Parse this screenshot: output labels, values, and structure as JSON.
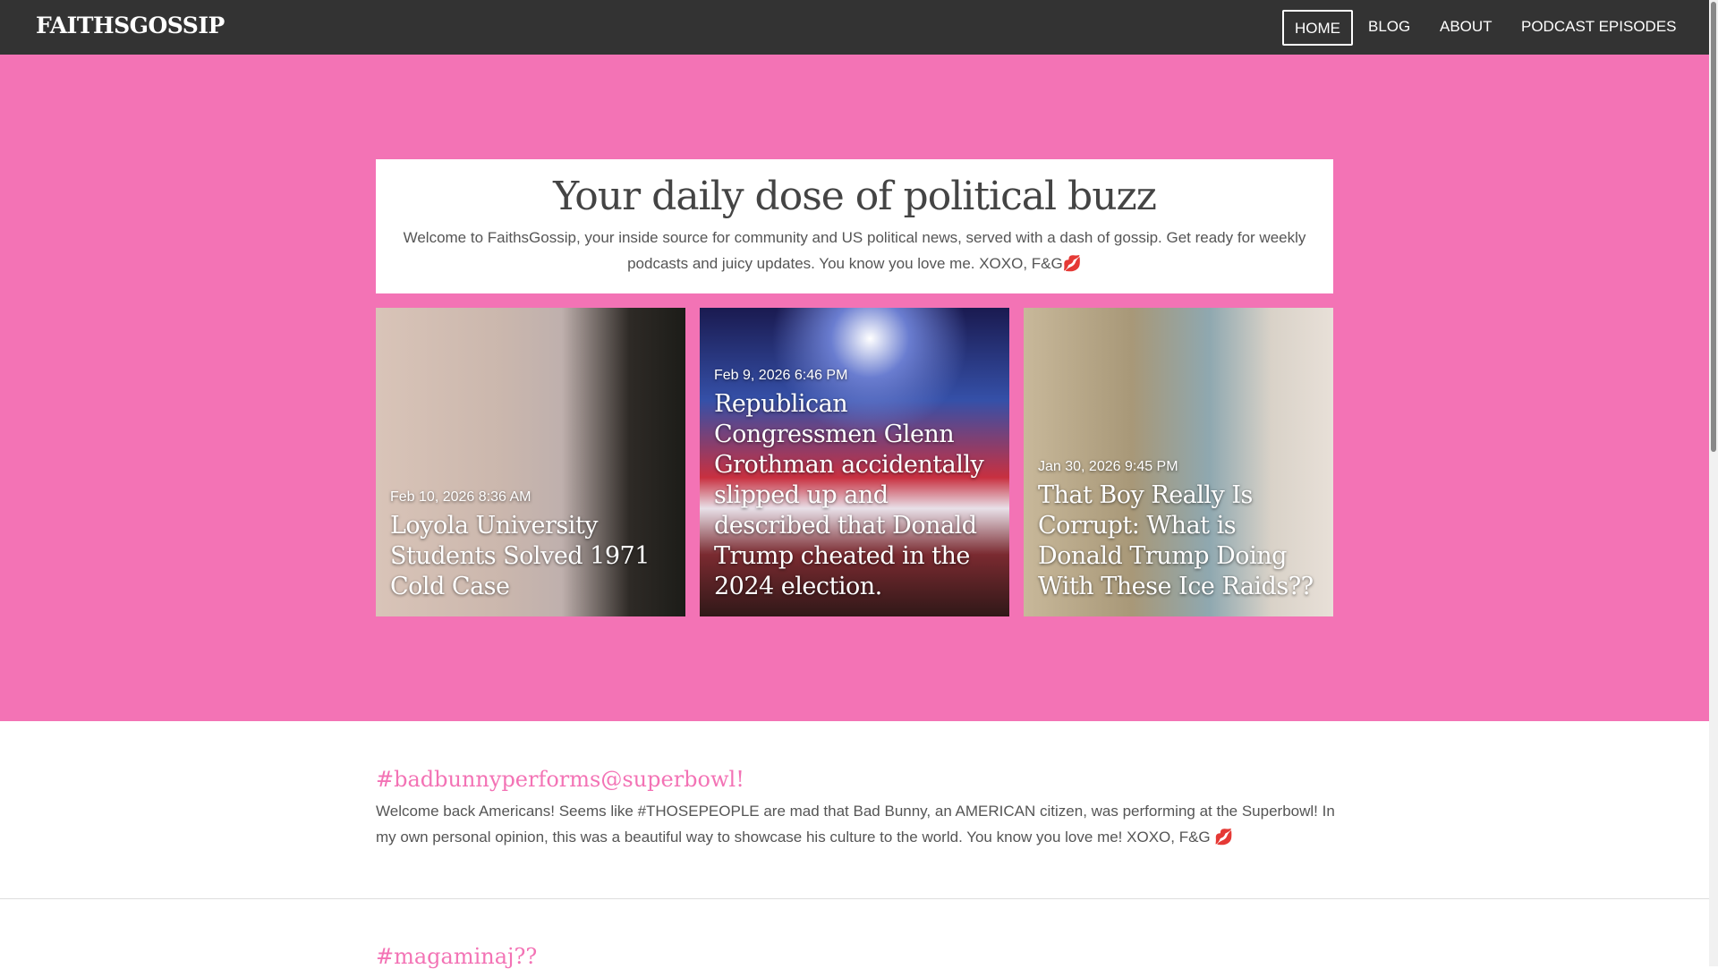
{
  "header": {
    "logo": "FAITHSGOSSIP",
    "nav": [
      "HOME",
      "BLOG",
      "ABOUT",
      "PODCAST EPISODES"
    ]
  },
  "intro": {
    "title": "Your daily dose of political buzz",
    "text": "Welcome to FaithsGossip, your inside source for community and US political news, served with a dash of gossip. Get ready for weekly podcasts and juicy updates. You know you love me. XOXO, F&G💋"
  },
  "featured": [
    {
      "date": "Feb 10, 2026 8:36 AM",
      "title": "Loyola University Students Solved 1971 Cold Case"
    },
    {
      "date": "Feb 9, 2026 6:46 PM",
      "title": "Republican Congressmen Glenn Grothman accidentally slipped up and described that Donald Trump cheated in the 2024 election."
    },
    {
      "date": "Jan 30, 2026 9:45 PM",
      "title": "That Boy Really Is Corrupt: What is Donald Trump Doing With These Ice Raids??"
    }
  ],
  "posts": [
    {
      "title": "#badbunnyperforms@superbowl!",
      "body": "Welcome back Americans! Seems like #THOSEPEOPLE are mad that Bad Bunny, an AMERICAN citizen, was performing at the Superbowl! In my own personal opinion, this was a beautiful way to showcase his culture to the world. You know you love me! XOXO, F&G 💋"
    },
    {
      "title": "#magaminaj??"
    }
  ],
  "colors": {
    "accent": "#f373b5",
    "header": "#333333"
  }
}
